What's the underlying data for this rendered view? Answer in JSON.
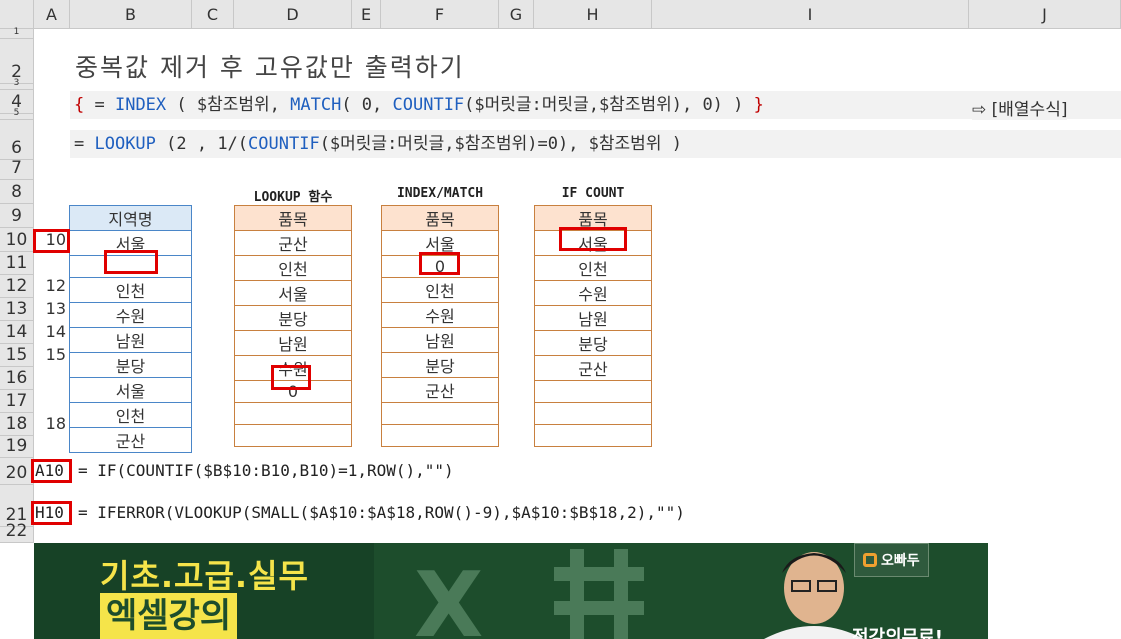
{
  "columns": [
    "A",
    "B",
    "C",
    "D",
    "E",
    "F",
    "G",
    "H",
    "I",
    "J"
  ],
  "rows": [
    "1",
    "2",
    "3",
    "4",
    "5",
    "6",
    "7",
    "8",
    "9",
    "10",
    "11",
    "12",
    "13",
    "14",
    "15",
    "16",
    "17",
    "18",
    "19",
    "20",
    "21",
    "22"
  ],
  "title": "중복값 제거 후 고유값만 출력하기",
  "formula1": {
    "open": "{ ",
    "eq": "= ",
    "index": "INDEX",
    "p1": " ( $참조범위, ",
    "match": "MATCH",
    "p2": "( 0, ",
    "countif": "COUNTIF",
    "p3": "($머릿글:머릿글,$참조범위), 0) ) ",
    "close": "}",
    "note": "⇨ [배열수식]"
  },
  "formula2": {
    "eq": "= ",
    "lookup": "LOOKUP",
    "p1": " (2 , 1/(",
    "countif": "COUNTIF",
    "p2": "($머릿글:머릿글,$참조범위)=0), $참조범위 )"
  },
  "table_region": {
    "header": "지역명",
    "values": [
      "서울",
      "",
      "인천",
      "수원",
      "남원",
      "분당",
      "서울",
      "인천",
      "군산"
    ],
    "helper": [
      "10",
      "",
      "12",
      "13",
      "14",
      "15",
      "",
      "",
      "18"
    ]
  },
  "table_lookup": {
    "caption": "LOOKUP 함수",
    "header": "품목",
    "values": [
      "군산",
      "인천",
      "서울",
      "분당",
      "남원",
      "수원",
      "0",
      "",
      ""
    ]
  },
  "table_index": {
    "caption": "INDEX/MATCH",
    "header": "품목",
    "values": [
      "서울",
      "0",
      "인천",
      "수원",
      "남원",
      "분당",
      "군산",
      "",
      ""
    ]
  },
  "table_ifcount": {
    "caption": "IF COUNT",
    "header": "품목",
    "values": [
      "서울",
      "인천",
      "수원",
      "남원",
      "분당",
      "군산",
      "",
      "",
      ""
    ]
  },
  "ref_a10": {
    "cell": "A10",
    "formula": "= IF(COUNTIF($B$10:B10,B10)=1,ROW(),\"\")"
  },
  "ref_h10": {
    "cell": "H10",
    "formula": "= IFERROR(VLOOKUP(SMALL($A$10:$A$18,ROW()-9),$A$10:$B$18,2),\"\")"
  },
  "banner": {
    "line1": "기초.고급.실무",
    "line2": "엑셀강의",
    "brand": "오빠두",
    "tagline": "전강의무료!"
  }
}
